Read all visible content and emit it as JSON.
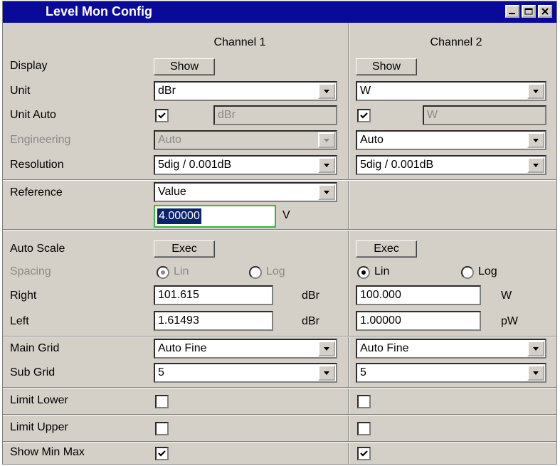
{
  "window": {
    "title": "Level Mon Config"
  },
  "columns": {
    "ch1": "Channel 1",
    "ch2": "Channel 2"
  },
  "rows": {
    "display": "Display",
    "unit": "Unit",
    "unit_auto": "Unit Auto",
    "engineering": "Engineering",
    "resolution": "Resolution",
    "reference": "Reference",
    "auto_scale": "Auto Scale",
    "spacing": "Spacing",
    "right": "Right",
    "left": "Left",
    "main_grid": "Main Grid",
    "sub_grid": "Sub Grid",
    "limit_lower": "Limit Lower",
    "limit_upper": "Limit Upper",
    "show_min_max": "Show Min Max"
  },
  "ch1": {
    "display_btn": "Show",
    "unit": "dBr",
    "unit_auto_checked": true,
    "unit_auto_field": "dBr",
    "engineering": "Auto",
    "resolution": "5dig / 0.001dB",
    "reference_mode": "Value",
    "reference_value": "4.00000",
    "reference_unit": "V",
    "auto_scale_btn": "Exec",
    "spacing_lin": "Lin",
    "spacing_log": "Log",
    "spacing_selected": "Lin",
    "right_value": "101.615",
    "right_unit": "dBr",
    "left_value": "1.61493",
    "left_unit": "dBr",
    "main_grid": "Auto Fine",
    "sub_grid": "5",
    "limit_lower": false,
    "limit_upper": false,
    "show_min_max": true
  },
  "ch2": {
    "display_btn": "Show",
    "unit": "W",
    "unit_auto_checked": true,
    "unit_auto_field": "W",
    "engineering": "Auto",
    "resolution": "5dig / 0.001dB",
    "auto_scale_btn": "Exec",
    "spacing_lin": "Lin",
    "spacing_log": "Log",
    "spacing_selected": "Lin",
    "right_value": "100.000",
    "right_unit": "W",
    "left_value": "1.00000",
    "left_unit": "pW",
    "main_grid": "Auto Fine",
    "sub_grid": "5",
    "limit_lower": false,
    "limit_upper": false,
    "show_min_max": true
  },
  "colors": {
    "titlebar": "#0a0a9a",
    "panel": "#d4d0c8",
    "disabled_text": "#8a8a8a",
    "focus_border": "#3cb43c",
    "selection": "#0a246a"
  },
  "icons": {
    "minimize": "minimize-icon",
    "maximize": "maximize-icon",
    "close": "close-icon",
    "dropdown": "chevron-down-icon",
    "check": "check-icon"
  }
}
